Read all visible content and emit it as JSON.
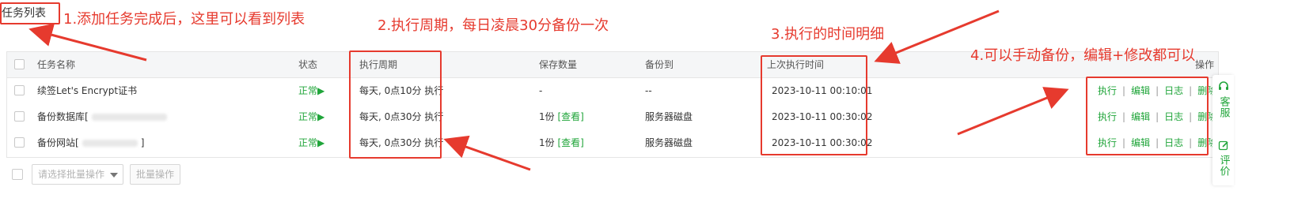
{
  "section_title": "任务列表",
  "table": {
    "headers": {
      "name": "任务名称",
      "status": "状态",
      "period": "执行周期",
      "retain": "保存数量",
      "backup_to": "备份到",
      "last_exec": "上次执行时间",
      "actions": "操作"
    },
    "rows": [
      {
        "name": "续签Let's Encrypt证书",
        "status": "正常▶",
        "period": "每天, 0点10分 执行",
        "retain": "-",
        "retain_link": "",
        "backup_to": "--",
        "last_exec": "2023-10-11 00:10:01"
      },
      {
        "name": "备份数据库[",
        "status": "正常▶",
        "period": "每天, 0点30分 执行",
        "retain": "1份",
        "retain_link": "[查看]",
        "backup_to": "服务器磁盘",
        "last_exec": "2023-10-11 00:30:02"
      },
      {
        "name": "备份网站[",
        "name_suffix": "]",
        "status": "正常▶",
        "period": "每天, 0点30分 执行",
        "retain": "1份",
        "retain_link": "[查看]",
        "backup_to": "服务器磁盘",
        "last_exec": "2023-10-11 00:30:02"
      }
    ],
    "action_labels": {
      "execute": "执行",
      "edit": "编辑",
      "log": "日志",
      "delete": "删除",
      "separator": "|"
    }
  },
  "batch": {
    "select_placeholder": "请选择批量操作",
    "button_label": "批量操作"
  },
  "float_panel": {
    "service_label": "客服",
    "review_label": "评价"
  },
  "annotations": {
    "note1": "1.添加任务完成后，这里可以看到列表",
    "note2": "2.执行周期，每日凌晨30分备份一次",
    "note3": "3.执行的时间明细",
    "note4": "4.可以手动备份，编辑+修改都可以"
  },
  "colors": {
    "accent_green": "#20a53a",
    "annotation_red": "#e63a2e",
    "header_bg": "#f5f6f7"
  }
}
